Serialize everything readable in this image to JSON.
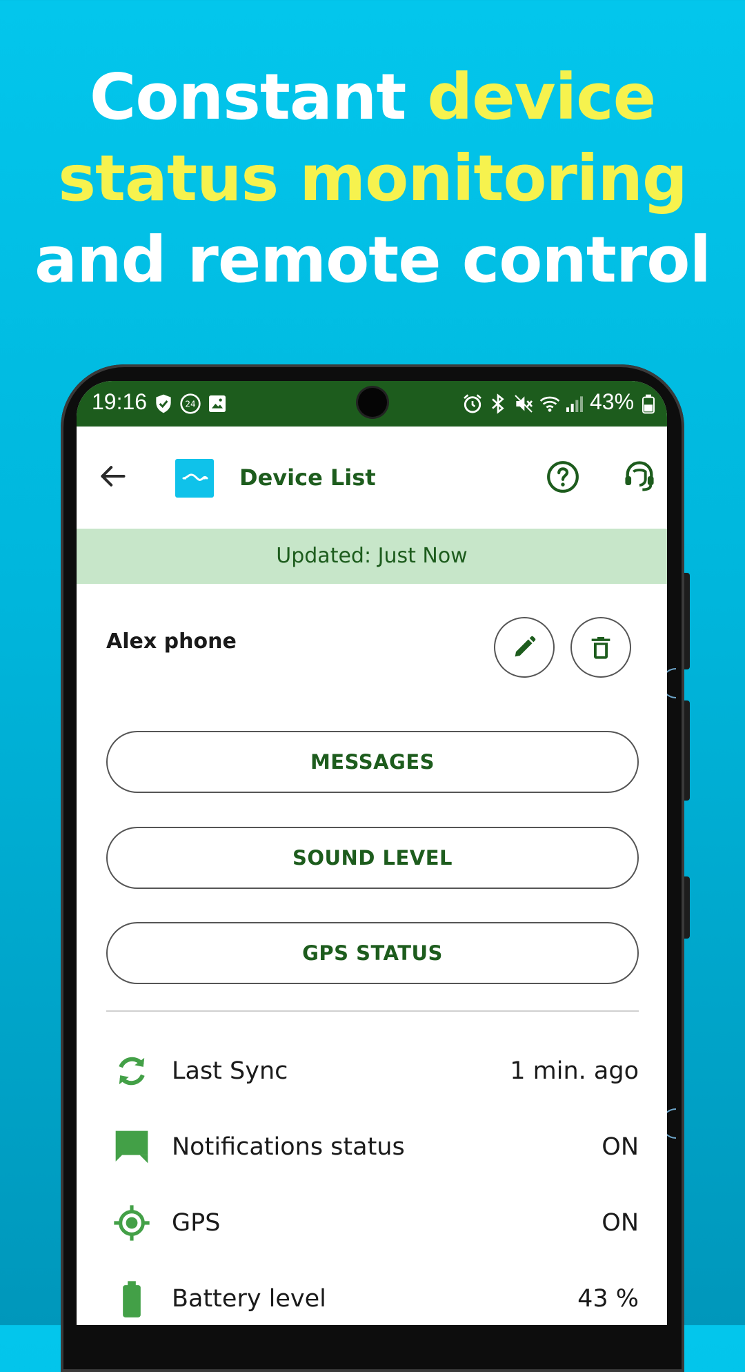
{
  "headline": {
    "line1_white": "Constant ",
    "line1_yellow": "device",
    "line2_yellow": "status monitoring",
    "line3_white": "and remote control"
  },
  "status_bar": {
    "time": "19:16",
    "battery_percent": "43%",
    "left_icons": [
      "shield-check-icon",
      "24-hour-icon",
      "image-icon"
    ],
    "right_icons": [
      "alarm-icon",
      "bluetooth-icon",
      "mute-icon",
      "wifi-icon",
      "signal-icon",
      "battery-icon"
    ]
  },
  "app_bar": {
    "title": "Device List",
    "icons": [
      "back-arrow-icon",
      "app-logo-icon",
      "help-icon",
      "support-headset-icon"
    ]
  },
  "banner": {
    "text": "Updated: Just Now"
  },
  "device": {
    "name": "Alex phone"
  },
  "actions": {
    "messages": "MESSAGES",
    "sound_level": "SOUND LEVEL",
    "gps_status": "GPS STATUS"
  },
  "status_rows": [
    {
      "label": "Last Sync",
      "value": "1 min. ago",
      "icon": "sync-icon"
    },
    {
      "label": "Notifications status",
      "value": "ON",
      "icon": "chat-bubble-icon"
    },
    {
      "label": "GPS",
      "value": "ON",
      "icon": "gps-target-icon"
    },
    {
      "label": "Battery level",
      "value": "43 %",
      "icon": "battery-icon"
    }
  ],
  "colors": {
    "background_top": "#03c6ec",
    "background_bottom": "#0097bb",
    "headline_white": "#ffffff",
    "headline_yellow": "#f6f24e",
    "primary_green": "#1d5c1d",
    "icon_green": "#43a047",
    "banner_green": "#c7e6c9",
    "logo_blue": "#0fc2ea"
  }
}
